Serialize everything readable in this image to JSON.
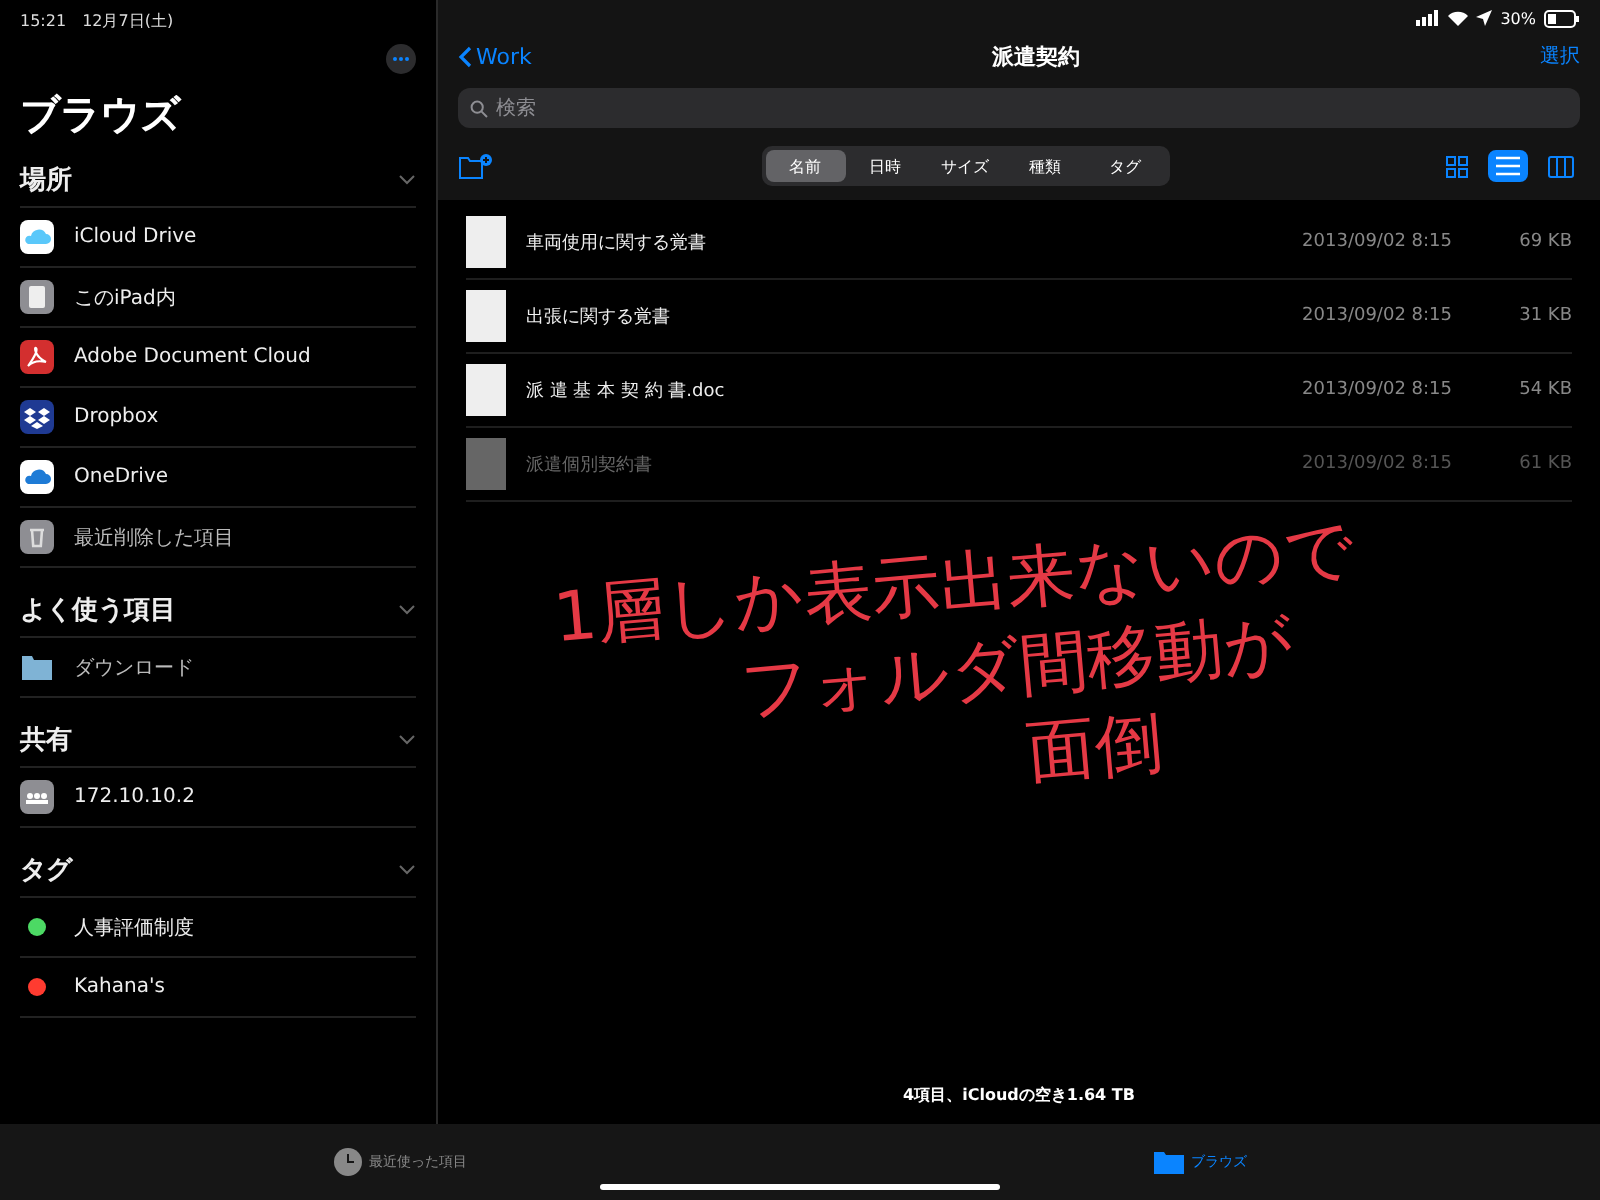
{
  "status_bar": {
    "time": "15:21",
    "date": "12月7日(土)",
    "battery": "30%"
  },
  "sidebar": {
    "title": "ブラウズ",
    "sections": [
      {
        "title": "場所",
        "expanded": true,
        "items": [
          {
            "label": "iCloud Drive",
            "kind": "icloud"
          },
          {
            "label": "このiPad内",
            "kind": "ipad"
          },
          {
            "label": "Adobe Document Cloud",
            "kind": "adobe"
          },
          {
            "label": "Dropbox",
            "kind": "dropbox"
          },
          {
            "label": "OneDrive",
            "kind": "onedrive"
          },
          {
            "label": "最近削除した項目",
            "kind": "trash"
          }
        ]
      },
      {
        "title": "よく使う項目",
        "expanded": true,
        "items": [
          {
            "label": "ダウンロード",
            "kind": "folder"
          }
        ]
      },
      {
        "title": "共有",
        "expanded": true,
        "items": [
          {
            "label": "172.10.10.2",
            "kind": "server"
          }
        ]
      },
      {
        "title": "タグ",
        "expanded": true,
        "items": [
          {
            "label": "人事評価制度",
            "kind": "tag",
            "color": "#4cd964"
          },
          {
            "label": "Kahana's",
            "kind": "tag",
            "color": "#ff3b30"
          }
        ]
      }
    ]
  },
  "nav": {
    "back": "Work",
    "title": "派遣契約",
    "action": "選択"
  },
  "search": {
    "placeholder": "検索"
  },
  "sort_tabs": [
    {
      "label": "名前",
      "selected": true
    },
    {
      "label": "日時",
      "selected": false
    },
    {
      "label": "サイズ",
      "selected": false
    },
    {
      "label": "種類",
      "selected": false
    },
    {
      "label": "タグ",
      "selected": false
    }
  ],
  "view_modes": [
    {
      "kind": "grid",
      "selected": false
    },
    {
      "kind": "list",
      "selected": true
    },
    {
      "kind": "columns",
      "selected": false
    }
  ],
  "files": [
    {
      "name": "車両使用に関する覚書",
      "date": "2013/09/02 8:15",
      "size": "69 KB",
      "dimmed": false
    },
    {
      "name": "出張に関する覚書",
      "date": "2013/09/02 8:15",
      "size": "31 KB",
      "dimmed": false
    },
    {
      "name": "派 遣 基 本 契 約 書.doc",
      "date": "2013/09/02 8:15",
      "size": "54 KB",
      "dimmed": false
    },
    {
      "name": "派遣個別契約書",
      "date": "2013/09/02 8:15",
      "size": "61 KB",
      "dimmed": true
    }
  ],
  "footer": "4項目、iCloudの空き1.64 TB",
  "annotation": [
    "1層しか表示出来ないので",
    "フォルダ間移動が",
    "面倒"
  ],
  "tab_bar": [
    {
      "label": "最近使った項目",
      "kind": "recents",
      "selected": false
    },
    {
      "label": "ブラウズ",
      "kind": "browse",
      "selected": true
    }
  ]
}
